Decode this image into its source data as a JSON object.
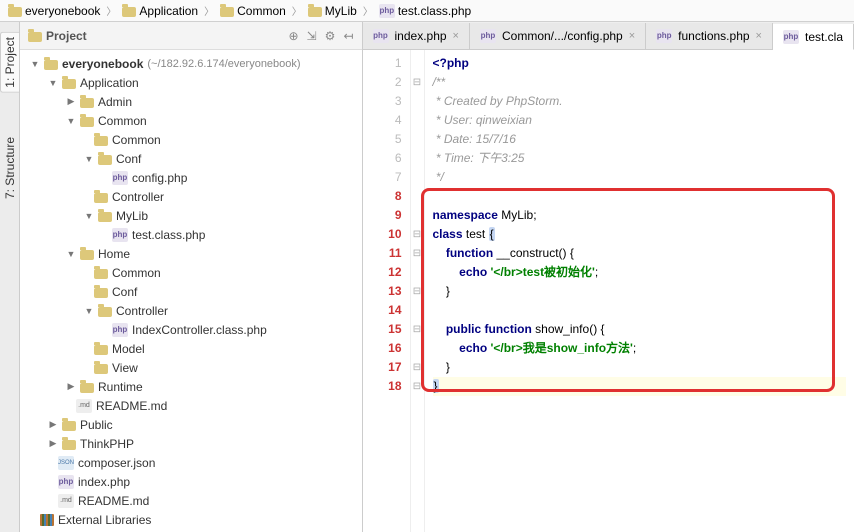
{
  "breadcrumb": [
    {
      "icon": "folder",
      "label": "everyonebook"
    },
    {
      "icon": "folder",
      "label": "Application"
    },
    {
      "icon": "folder",
      "label": "Common"
    },
    {
      "icon": "folder",
      "label": "MyLib"
    },
    {
      "icon": "php",
      "label": "test.class.php"
    }
  ],
  "sidetabs": {
    "project": "1: Project",
    "structure": "7: Structure"
  },
  "project_panel": {
    "title": "Project",
    "tree": {
      "root_name": "everyonebook",
      "root_path": "(~/182.92.6.174/everyonebook)",
      "items": {
        "application": "Application",
        "admin": "Admin",
        "common": "Common",
        "common2": "Common",
        "conf": "Conf",
        "config": "config.php",
        "controller": "Controller",
        "mylib": "MyLib",
        "testclass": "test.class.php",
        "home": "Home",
        "common3": "Common",
        "conf2": "Conf",
        "controller2": "Controller",
        "indexctrl": "IndexController.class.php",
        "model": "Model",
        "view": "View",
        "runtime": "Runtime",
        "readme": "README.md",
        "public": "Public",
        "thinkphp": "ThinkPHP",
        "composer": "composer.json",
        "index": "index.php",
        "readme2": "README.md",
        "extlib": "External Libraries"
      }
    }
  },
  "tabs": [
    {
      "label": "index.php",
      "icon": "php"
    },
    {
      "label": "Common/.../config.php",
      "icon": "php"
    },
    {
      "label": "functions.php",
      "icon": "php"
    },
    {
      "label": "test.cla",
      "icon": "php",
      "active": true
    }
  ],
  "code": {
    "l1": "<?php",
    "l2": "/**",
    "l3": " * Created by PhpStorm.",
    "l4_a": " * User: ",
    "l4_b": "qinweixian",
    "l5_a": " * Date: ",
    "l5_b": "15/7/16",
    "l6": " * Time: 下午3:25",
    "l7": " */",
    "l8": "",
    "l9_a": "namespace ",
    "l9_b": "MyLib;",
    "l10_a": "class ",
    "l10_b": "test ",
    "l10_c": "{",
    "l11_a": "    function ",
    "l11_b": "__construct() {",
    "l12_a": "        echo ",
    "l12_b": "'</br>test被初始化'",
    "l12_c": ";",
    "l13": "    }",
    "l14": "",
    "l15_a": "    public function ",
    "l15_b": "show_info() {",
    "l16_a": "        echo ",
    "l16_b": "'</br>我是show_info方法'",
    "l16_c": ";",
    "l17": "    }",
    "l18": "}"
  },
  "line_numbers": [
    "1",
    "2",
    "3",
    "4",
    "5",
    "6",
    "7",
    "8",
    "9",
    "10",
    "11",
    "12",
    "13",
    "14",
    "15",
    "16",
    "17",
    "18"
  ]
}
